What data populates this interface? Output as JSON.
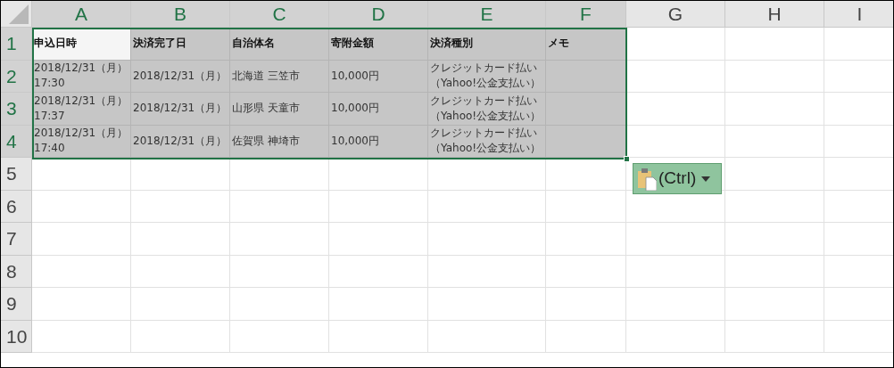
{
  "columns": [
    {
      "label": "A",
      "selected": true
    },
    {
      "label": "B",
      "selected": true
    },
    {
      "label": "C",
      "selected": true
    },
    {
      "label": "D",
      "selected": true
    },
    {
      "label": "E",
      "selected": true
    },
    {
      "label": "F",
      "selected": true
    },
    {
      "label": "G",
      "selected": false
    },
    {
      "label": "H",
      "selected": false
    },
    {
      "label": "I",
      "selected": false
    }
  ],
  "rows": [
    {
      "label": "1",
      "selected": true,
      "kind": "header",
      "cells": [
        {
          "lines": [
            "申込日時"
          ],
          "active": true
        },
        {
          "lines": [
            "決済完了日"
          ],
          "active": false
        },
        {
          "lines": [
            "自治体名"
          ],
          "active": false
        },
        {
          "lines": [
            "寄附金額"
          ],
          "active": false
        },
        {
          "lines": [
            "決済種別"
          ],
          "active": false
        },
        {
          "lines": [
            "メモ"
          ],
          "active": false
        }
      ]
    },
    {
      "label": "2",
      "selected": true,
      "kind": "data",
      "cells": [
        {
          "lines": [
            "2018/12/31（月）",
            "17:30"
          ],
          "active": false
        },
        {
          "lines": [
            "2018/12/31（月）"
          ],
          "active": false
        },
        {
          "lines": [
            "北海道 三笠市"
          ],
          "active": false
        },
        {
          "lines": [
            "10,000円"
          ],
          "active": false
        },
        {
          "lines": [
            "クレジットカード払い",
            "（Yahoo!公金支払い）"
          ],
          "active": false
        },
        {
          "active": false
        }
      ]
    },
    {
      "label": "3",
      "selected": true,
      "kind": "data",
      "cells": [
        {
          "lines": [
            "2018/12/31（月）",
            "17:37"
          ],
          "active": false
        },
        {
          "lines": [
            "2018/12/31（月）"
          ],
          "active": false
        },
        {
          "lines": [
            "山形県 天童市"
          ],
          "active": false
        },
        {
          "lines": [
            "10,000円"
          ],
          "active": false
        },
        {
          "lines": [
            "クレジットカード払い",
            "（Yahoo!公金支払い）"
          ],
          "active": false
        },
        {
          "active": false
        }
      ]
    },
    {
      "label": "4",
      "selected": true,
      "kind": "data",
      "cells": [
        {
          "lines": [
            "2018/12/31（月）",
            "17:40"
          ],
          "active": false
        },
        {
          "lines": [
            "2018/12/31（月）"
          ],
          "active": false
        },
        {
          "lines": [
            "佐賀県 神埼市"
          ],
          "active": false
        },
        {
          "lines": [
            "10,000円"
          ],
          "active": false
        },
        {
          "lines": [
            "クレジットカード払い",
            "（Yahoo!公金支払い）"
          ],
          "active": false
        },
        {
          "active": false
        }
      ]
    },
    {
      "label": "5",
      "selected": false
    },
    {
      "label": "6",
      "selected": false
    },
    {
      "label": "7",
      "selected": false
    },
    {
      "label": "8",
      "selected": false
    },
    {
      "label": "9",
      "selected": false
    },
    {
      "label": "10",
      "selected": false
    }
  ],
  "paste_options": {
    "label": "(Ctrl)"
  }
}
